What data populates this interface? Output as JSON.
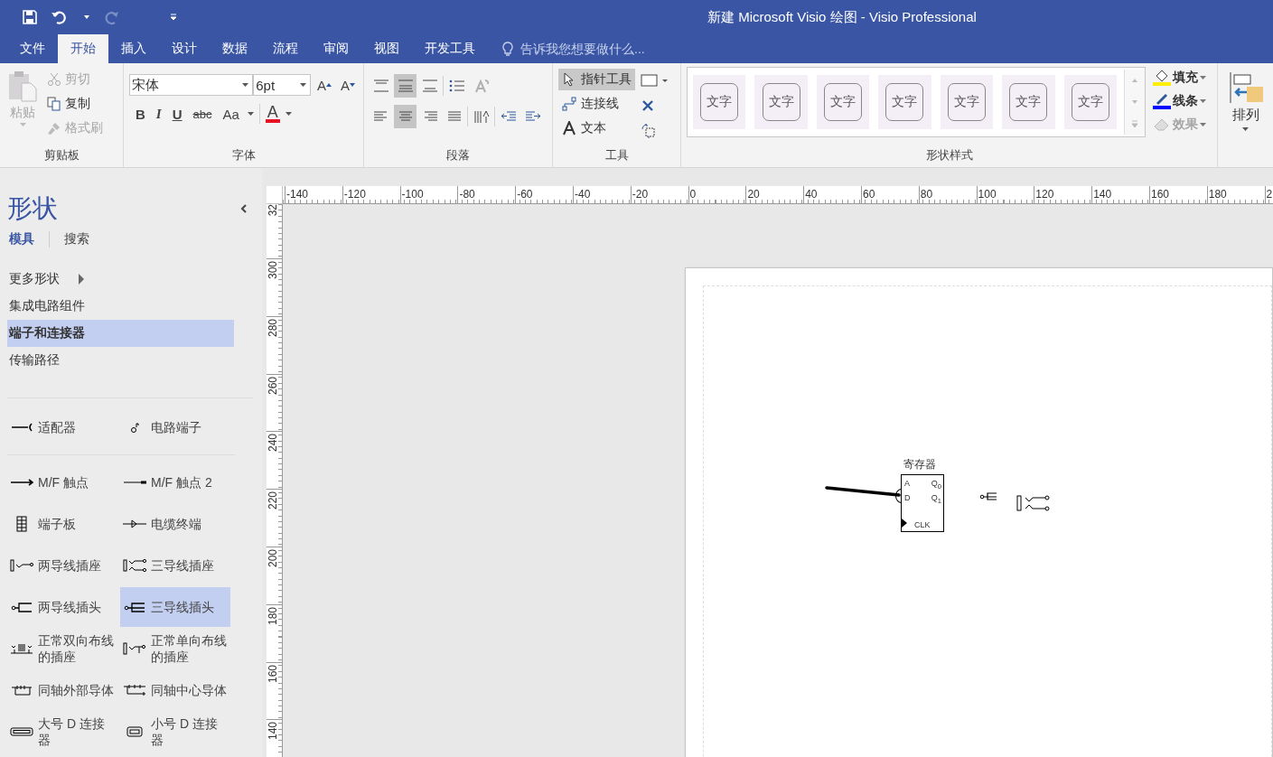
{
  "window": {
    "title": "新建 Microsoft Visio 绘图 - Visio Professional"
  },
  "tabs": [
    {
      "label": "文件",
      "selected": false
    },
    {
      "label": "开始",
      "selected": true
    },
    {
      "label": "插入",
      "selected": false
    },
    {
      "label": "设计",
      "selected": false
    },
    {
      "label": "数据",
      "selected": false
    },
    {
      "label": "流程",
      "selected": false
    },
    {
      "label": "审阅",
      "selected": false
    },
    {
      "label": "视图",
      "selected": false
    },
    {
      "label": "开发工具",
      "selected": false
    }
  ],
  "tell_me": {
    "placeholder": "告诉我您想要做什么..."
  },
  "ribbon": {
    "clipboard": {
      "label": "剪贴板",
      "paste": {
        "label": "粘贴",
        "disabled": true
      },
      "items": [
        {
          "kind": "cut",
          "label": "剪切",
          "disabled": true
        },
        {
          "kind": "copy",
          "label": "复制",
          "disabled": false
        },
        {
          "kind": "painter",
          "label": "格式刷",
          "disabled": true
        }
      ]
    },
    "font": {
      "label": "字体",
      "font_name": "宋体",
      "font_size": "6pt",
      "size_buttons": [
        {
          "kind": "grow",
          "label": "A"
        },
        {
          "kind": "shrink",
          "label": "A"
        }
      ],
      "format_buttons": [
        {
          "kind": "bold",
          "label": "B"
        },
        {
          "kind": "italic",
          "label": "I"
        },
        {
          "kind": "underline",
          "label": "U"
        },
        {
          "kind": "strike",
          "label": "abc"
        },
        {
          "kind": "case",
          "label": "Aa"
        }
      ],
      "color_button": {
        "label": "A",
        "color": "#e81123"
      }
    },
    "paragraph": {
      "label": "段落",
      "rows": [
        [
          {
            "kind": "align-top",
            "selected": false
          },
          {
            "kind": "align-middle",
            "selected": true
          },
          {
            "kind": "align-bottom",
            "selected": false
          },
          {
            "kind": "bullets",
            "selected": false
          },
          {
            "kind": "rotate",
            "selected": false
          }
        ],
        [
          {
            "kind": "align-left",
            "selected": false
          },
          {
            "kind": "align-center",
            "selected": true
          },
          {
            "kind": "align-right",
            "selected": false
          },
          {
            "kind": "justify",
            "selected": false
          },
          {
            "kind": "direction",
            "selected": false
          },
          {
            "kind": "outdent",
            "selected": false
          },
          {
            "kind": "indent",
            "selected": false
          }
        ]
      ]
    },
    "tools": {
      "label": "工具",
      "items": [
        {
          "kind": "pointer",
          "label": "指针工具",
          "selected": true
        },
        {
          "kind": "connector",
          "label": "连接线",
          "selected": false
        },
        {
          "kind": "text",
          "label": "文本",
          "selected": false
        }
      ]
    },
    "shape_styles": {
      "label": "形状样式",
      "swatches": [
        {
          "label": "文字"
        },
        {
          "label": "文字"
        },
        {
          "label": "文字"
        },
        {
          "label": "文字"
        },
        {
          "label": "文字"
        },
        {
          "label": "文字"
        },
        {
          "label": "文字"
        }
      ],
      "options": [
        {
          "kind": "fill",
          "label": "填充",
          "disabled": false
        },
        {
          "kind": "line",
          "label": "线条",
          "disabled": false
        },
        {
          "kind": "effects",
          "label": "效果",
          "disabled": true
        }
      ]
    },
    "arrange": {
      "label": "排列"
    }
  },
  "shapes_panel": {
    "title": "形状",
    "tabs": [
      {
        "label": "模具",
        "selected": true
      },
      {
        "label": "搜索",
        "selected": false
      }
    ],
    "stencils": [
      {
        "label": "更多形状",
        "kind": "menu",
        "selected": false
      },
      {
        "label": "集成电路组件",
        "kind": "stencil",
        "selected": false
      },
      {
        "label": "端子和连接器",
        "kind": "stencil",
        "selected": true
      },
      {
        "label": "传输路径",
        "kind": "stencil",
        "selected": false
      }
    ],
    "shape_groups": [
      [
        {
          "label": "适配器",
          "kind": "adapter",
          "selected": false
        },
        {
          "label": "电路端子",
          "kind": "terminal",
          "selected": false
        }
      ],
      [
        {
          "label": "M/F 触点",
          "kind": "mf",
          "selected": false
        },
        {
          "label": "M/F 触点 2",
          "kind": "mf2",
          "selected": false
        },
        {
          "label": "端子板",
          "kind": "board",
          "selected": false
        },
        {
          "label": "电缆终端",
          "kind": "cable",
          "selected": false
        },
        {
          "label": "两导线插座",
          "kind": "jack2",
          "selected": false
        },
        {
          "label": "三导线插座",
          "kind": "jack3",
          "selected": false
        },
        {
          "label": "两导线插头",
          "kind": "plug2",
          "selected": false
        },
        {
          "label": "三导线插头",
          "kind": "plug3",
          "selected": true
        },
        {
          "label": "正常双向布线的插座",
          "kind": "bijack",
          "selected": false
        },
        {
          "label": "正常单向布线的插座",
          "kind": "unijack",
          "selected": false
        },
        {
          "label": "同轴外部导体",
          "kind": "coaxout",
          "selected": false
        },
        {
          "label": "同轴中心导体",
          "kind": "coaxcenter",
          "selected": false
        },
        {
          "label": "大号 D 连接器",
          "kind": "dbig",
          "selected": false
        },
        {
          "label": "小号 D 连接器",
          "kind": "dsmall",
          "selected": false
        }
      ]
    ]
  },
  "rulers": {
    "horizontal": [
      "-140",
      "-120",
      "-100",
      "-80",
      "-60",
      "-40",
      "-20",
      "0",
      "20",
      "40",
      "60",
      "80",
      "100",
      "120",
      "140",
      "160",
      "180",
      "2"
    ],
    "vertical": [
      "32",
      "300",
      "280",
      "260",
      "240",
      "220",
      "200",
      "180",
      "160",
      "140"
    ]
  },
  "drawing": {
    "register": {
      "title": "寄存器",
      "inputs": [
        "A",
        "D"
      ],
      "outputs": [
        "Q$_{0}$",
        "Q$_{1}$"
      ],
      "clock": "CLK"
    }
  }
}
